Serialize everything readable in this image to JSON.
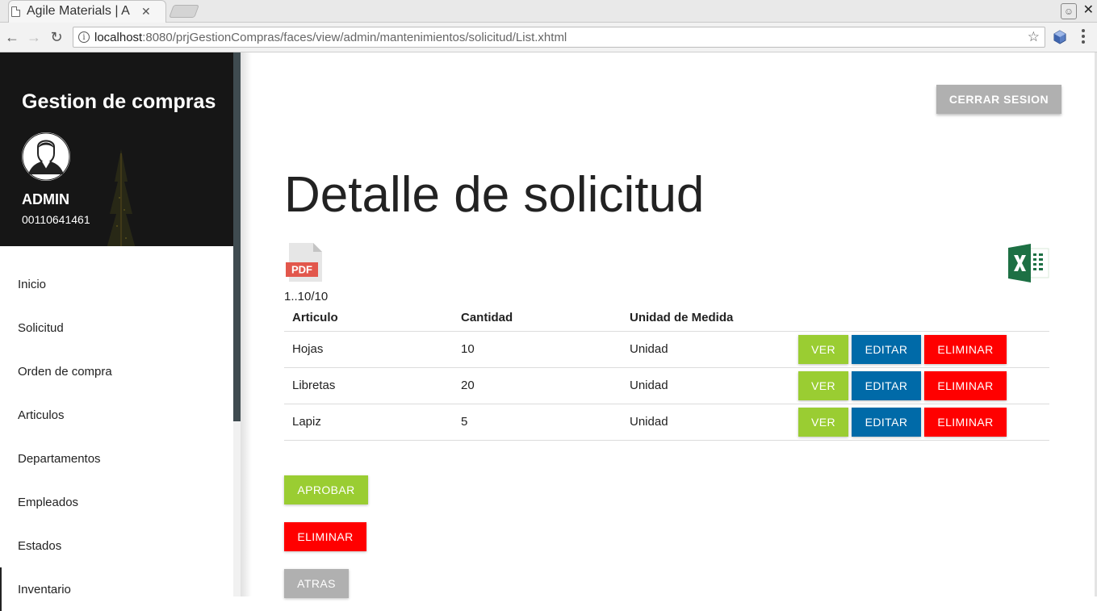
{
  "browser": {
    "tab_title": "Agile Materials | A",
    "url_host": "localhost",
    "url_rest": ":8080/prjGestionCompras/faces/view/admin/mantenimientos/solicitud/List.xhtml"
  },
  "sidebar": {
    "app_title": "Gestion de compras",
    "user_name": "ADMIN",
    "user_id": "00110641461",
    "items": [
      {
        "label": "Inicio"
      },
      {
        "label": "Solicitud"
      },
      {
        "label": "Orden de compra"
      },
      {
        "label": "Articulos"
      },
      {
        "label": "Departamentos"
      },
      {
        "label": "Empleados"
      },
      {
        "label": "Estados"
      },
      {
        "label": "Inventario"
      }
    ]
  },
  "header": {
    "logout_label": "CERRAR SESION"
  },
  "main": {
    "title": "Detalle de solicitud",
    "pdf_label": "PDF",
    "pager": "1..10/10",
    "table": {
      "columns": [
        "Articulo",
        "Cantidad",
        "Unidad de Medida"
      ],
      "rows": [
        {
          "articulo": "Hojas",
          "cantidad": "10",
          "unidad": "Unidad"
        },
        {
          "articulo": "Libretas",
          "cantidad": "20",
          "unidad": "Unidad"
        },
        {
          "articulo": "Lapiz",
          "cantidad": "5",
          "unidad": "Unidad"
        }
      ],
      "actions": {
        "view": "VER",
        "edit": "EDITAR",
        "delete": "ELIMINAR"
      }
    },
    "buttons": {
      "approve": "APROBAR",
      "delete": "ELIMINAR",
      "back": "ATRAS"
    }
  },
  "colors": {
    "green": "#9acd32",
    "blue": "#006aa8",
    "red": "#ff0000",
    "gray": "#b0b0b0"
  }
}
